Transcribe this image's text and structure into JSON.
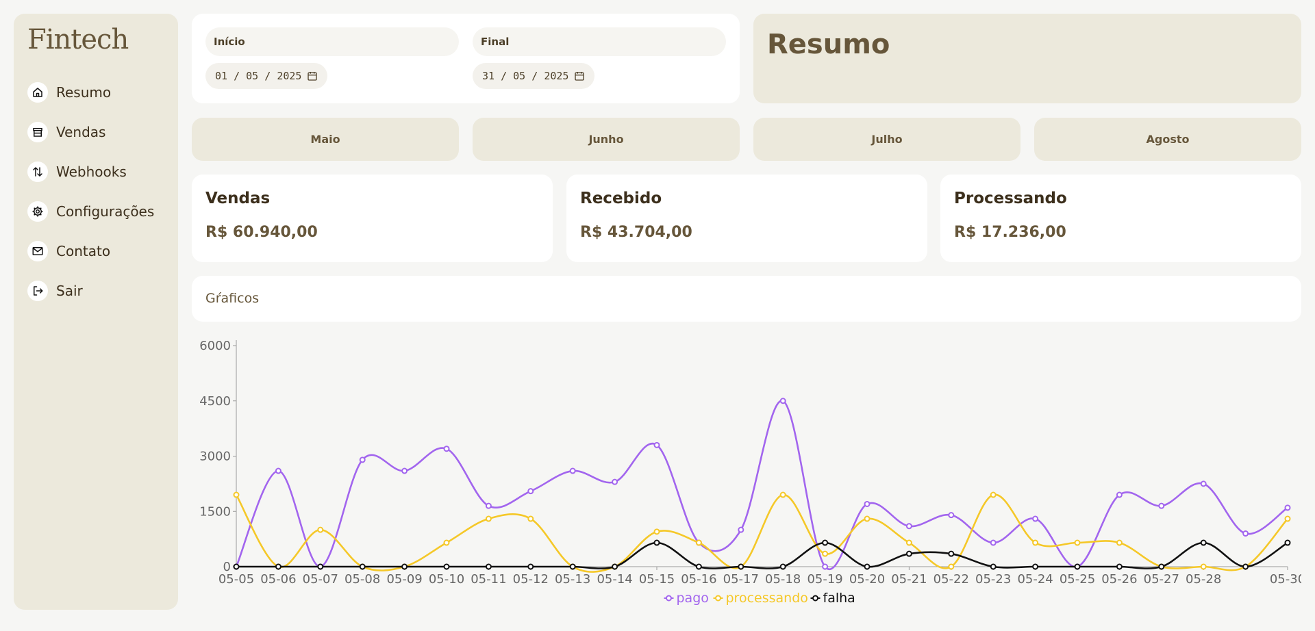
{
  "app": {
    "logo": "Fintech"
  },
  "sidebar": {
    "items": [
      {
        "label": "Resumo",
        "icon": "home-icon"
      },
      {
        "label": "Vendas",
        "icon": "store-icon"
      },
      {
        "label": "Webhooks",
        "icon": "arrows-updown-icon"
      },
      {
        "label": "Configurações",
        "icon": "gear-icon"
      },
      {
        "label": "Contato",
        "icon": "mail-icon"
      },
      {
        "label": "Sair",
        "icon": "logout-icon"
      }
    ]
  },
  "filters": {
    "start": {
      "label": "Início",
      "day": "01",
      "month": "05",
      "year": "2025"
    },
    "end": {
      "label": "Final",
      "day": "31",
      "month": "05",
      "year": "2025"
    }
  },
  "header": {
    "title": "Resumo"
  },
  "months": [
    "Maio",
    "Junho",
    "Julho",
    "Agosto"
  ],
  "stats": [
    {
      "title": "Vendas",
      "value": "R$ 60.940,00"
    },
    {
      "title": "Recebido",
      "value": "R$ 43.704,00"
    },
    {
      "title": "Processando",
      "value": "R$ 17.236,00"
    }
  ],
  "graficos": {
    "label": "Gŕaficos"
  },
  "colors": {
    "pago": "#a265ee",
    "processando": "#f5c828",
    "falha": "#111111",
    "accent": "#66563a",
    "panel": "#ece9dc"
  },
  "chart_data": {
    "type": "line",
    "x": [
      "05-05",
      "05-06",
      "05-07",
      "05-08",
      "05-09",
      "05-10",
      "05-11",
      "05-12",
      "05-13",
      "05-14",
      "05-15",
      "05-16",
      "05-17",
      "05-18",
      "05-19",
      "05-20",
      "05-21",
      "05-22",
      "05-23",
      "05-24",
      "05-25",
      "05-26",
      "05-27",
      "05-28",
      "05-29",
      "05-30"
    ],
    "x_tick_labels": [
      "05-05",
      "05-06",
      "05-07",
      "05-08",
      "05-09",
      "05-10",
      "05-11",
      "05-12",
      "05-13",
      "05-14",
      "05-15",
      "05-16",
      "05-17",
      "05-18",
      "05-19",
      "05-20",
      "05-21",
      "05-22",
      "05-23",
      "05-24",
      "05-25",
      "05-26",
      "05-27",
      "05-28",
      "",
      "05-30"
    ],
    "series": [
      {
        "name": "pago",
        "color": "#a265ee",
        "values": [
          0,
          2600,
          0,
          2900,
          2600,
          3200,
          1650,
          2050,
          2600,
          2300,
          3300,
          650,
          1000,
          4500,
          0,
          1700,
          1100,
          1400,
          650,
          1300,
          0,
          1950,
          1650,
          2250,
          900,
          1600
        ]
      },
      {
        "name": "processando",
        "color": "#f5c828",
        "values": [
          1950,
          0,
          1000,
          0,
          0,
          650,
          1300,
          1300,
          0,
          0,
          950,
          650,
          0,
          1950,
          350,
          1300,
          650,
          0,
          1950,
          650,
          650,
          650,
          0,
          0,
          0,
          1300
        ]
      },
      {
        "name": "falha",
        "color": "#111111",
        "values": [
          0,
          0,
          0,
          0,
          0,
          0,
          0,
          0,
          0,
          0,
          650,
          0,
          0,
          0,
          650,
          0,
          350,
          350,
          0,
          0,
          0,
          0,
          0,
          650,
          0,
          650
        ]
      }
    ],
    "yticks": [
      0,
      1500,
      3000,
      4500,
      6000
    ],
    "ylim": [
      0,
      6000
    ],
    "legend_position": "bottom-center",
    "grid": false
  }
}
